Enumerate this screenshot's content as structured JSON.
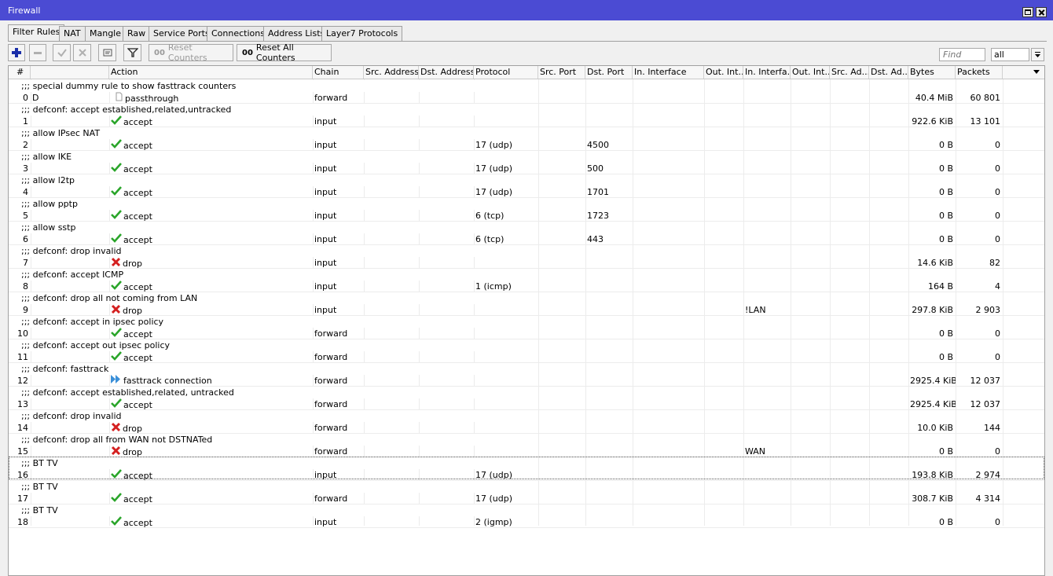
{
  "window": {
    "title": "Firewall"
  },
  "tabs": [
    {
      "label": "Filter Rules",
      "active": true
    },
    {
      "label": "NAT"
    },
    {
      "label": "Mangle"
    },
    {
      "label": "Raw"
    },
    {
      "label": "Service Ports"
    },
    {
      "label": "Connections"
    },
    {
      "label": "Address Lists"
    },
    {
      "label": "Layer7 Protocols"
    }
  ],
  "toolbar": {
    "add_icon": "plus-icon",
    "remove_icon": "minus-icon",
    "enable_icon": "check-icon",
    "disable_icon": "x-icon",
    "comment_icon": "comment-icon",
    "filter_icon": "filter-icon",
    "reset_counters_label": "Reset Counters",
    "reset_all_counters_label": "Reset All Counters",
    "counter_prefix": "00",
    "find_placeholder": "Find",
    "filter_select_value": "all"
  },
  "columns": [
    "#",
    "Action",
    "Chain",
    "Src. Address",
    "Dst. Address",
    "Protocol",
    "Src. Port",
    "Dst. Port",
    "In. Interface",
    "Out. Int...",
    "In. Interfa...",
    "Out. Int...",
    "Src. Ad...",
    "Dst. Ad...",
    "Bytes",
    "Packets"
  ],
  "rules": [
    {
      "comment": ";;; special dummy rule to show fasttrack counters",
      "num": "0",
      "flag": "D",
      "action": "passthrough",
      "action_icon": "document-icon",
      "chain": "forward",
      "protocol": "",
      "dst_port": "",
      "in_iface_list": "",
      "bytes": "40.4 MiB",
      "packets": "60 801"
    },
    {
      "comment": ";;; defconf: accept established,related,untracked",
      "num": "1",
      "flag": "",
      "action": "accept",
      "action_icon": "check-icon",
      "chain": "input",
      "protocol": "",
      "dst_port": "",
      "in_iface_list": "",
      "bytes": "922.6 KiB",
      "packets": "13 101"
    },
    {
      "comment": ";;; allow IPsec NAT",
      "num": "2",
      "flag": "",
      "action": "accept",
      "action_icon": "check-icon",
      "chain": "input",
      "protocol": "17 (udp)",
      "dst_port": "4500",
      "in_iface_list": "",
      "bytes": "0 B",
      "packets": "0"
    },
    {
      "comment": ";;; allow IKE",
      "num": "3",
      "flag": "",
      "action": "accept",
      "action_icon": "check-icon",
      "chain": "input",
      "protocol": "17 (udp)",
      "dst_port": "500",
      "in_iface_list": "",
      "bytes": "0 B",
      "packets": "0"
    },
    {
      "comment": ";;; allow l2tp",
      "num": "4",
      "flag": "",
      "action": "accept",
      "action_icon": "check-icon",
      "chain": "input",
      "protocol": "17 (udp)",
      "dst_port": "1701",
      "in_iface_list": "",
      "bytes": "0 B",
      "packets": "0"
    },
    {
      "comment": ";;; allow pptp",
      "num": "5",
      "flag": "",
      "action": "accept",
      "action_icon": "check-icon",
      "chain": "input",
      "protocol": "6 (tcp)",
      "dst_port": "1723",
      "in_iface_list": "",
      "bytes": "0 B",
      "packets": "0"
    },
    {
      "comment": ";;; allow sstp",
      "num": "6",
      "flag": "",
      "action": "accept",
      "action_icon": "check-icon",
      "chain": "input",
      "protocol": "6 (tcp)",
      "dst_port": "443",
      "in_iface_list": "",
      "bytes": "0 B",
      "packets": "0"
    },
    {
      "comment": ";;; defconf: drop invalid",
      "num": "7",
      "flag": "",
      "action": "drop",
      "action_icon": "x-icon",
      "chain": "input",
      "protocol": "",
      "dst_port": "",
      "in_iface_list": "",
      "bytes": "14.6 KiB",
      "packets": "82"
    },
    {
      "comment": ";;; defconf: accept ICMP",
      "num": "8",
      "flag": "",
      "action": "accept",
      "action_icon": "check-icon",
      "chain": "input",
      "protocol": "1 (icmp)",
      "dst_port": "",
      "in_iface_list": "",
      "bytes": "164 B",
      "packets": "4"
    },
    {
      "comment": ";;; defconf: drop all not coming from LAN",
      "num": "9",
      "flag": "",
      "action": "drop",
      "action_icon": "x-icon",
      "chain": "input",
      "protocol": "",
      "dst_port": "",
      "in_iface_list": "!LAN",
      "bytes": "297.8 KiB",
      "packets": "2 903"
    },
    {
      "comment": ";;; defconf: accept in ipsec policy",
      "num": "10",
      "flag": "",
      "action": "accept",
      "action_icon": "check-icon",
      "chain": "forward",
      "protocol": "",
      "dst_port": "",
      "in_iface_list": "",
      "bytes": "0 B",
      "packets": "0"
    },
    {
      "comment": ";;; defconf: accept out ipsec policy",
      "num": "11",
      "flag": "",
      "action": "accept",
      "action_icon": "check-icon",
      "chain": "forward",
      "protocol": "",
      "dst_port": "",
      "in_iface_list": "",
      "bytes": "0 B",
      "packets": "0"
    },
    {
      "comment": ";;; defconf: fasttrack",
      "num": "12",
      "flag": "",
      "action": "fasttrack connection",
      "action_icon": "fast-forward-icon",
      "chain": "forward",
      "protocol": "",
      "dst_port": "",
      "in_iface_list": "",
      "bytes": "2925.4 KiB",
      "packets": "12 037"
    },
    {
      "comment": ";;; defconf: accept established,related, untracked",
      "num": "13",
      "flag": "",
      "action": "accept",
      "action_icon": "check-icon",
      "chain": "forward",
      "protocol": "",
      "dst_port": "",
      "in_iface_list": "",
      "bytes": "2925.4 KiB",
      "packets": "12 037"
    },
    {
      "comment": ";;; defconf: drop invalid",
      "num": "14",
      "flag": "",
      "action": "drop",
      "action_icon": "x-icon",
      "chain": "forward",
      "protocol": "",
      "dst_port": "",
      "in_iface_list": "",
      "bytes": "10.0 KiB",
      "packets": "144"
    },
    {
      "comment": ";;; defconf:  drop all from WAN not DSTNATed",
      "num": "15",
      "flag": "",
      "action": "drop",
      "action_icon": "x-icon",
      "chain": "forward",
      "protocol": "",
      "dst_port": "",
      "in_iface_list": "WAN",
      "bytes": "0 B",
      "packets": "0"
    },
    {
      "comment": ";;; BT TV",
      "num": "16",
      "flag": "",
      "action": "accept",
      "action_icon": "check-icon",
      "chain": "input",
      "protocol": "17 (udp)",
      "dst_port": "",
      "in_iface_list": "",
      "bytes": "193.8 KiB",
      "packets": "2 974"
    },
    {
      "comment": ";;; BT TV",
      "num": "17",
      "flag": "",
      "action": "accept",
      "action_icon": "check-icon",
      "chain": "forward",
      "protocol": "17 (udp)",
      "dst_port": "",
      "in_iface_list": "",
      "bytes": "308.7 KiB",
      "packets": "4 314"
    },
    {
      "comment": ";;; BT TV",
      "num": "18",
      "flag": "",
      "action": "accept",
      "action_icon": "check-icon",
      "chain": "input",
      "protocol": "2 (igmp)",
      "dst_port": "",
      "in_iface_list": "",
      "bytes": "0 B",
      "packets": "0"
    }
  ],
  "colors": {
    "titlebar": "#4b4bd3",
    "accept": "#2aa52a",
    "drop": "#d42020",
    "fasttrack": "#3a8fd8",
    "add": "#1a2ea8"
  }
}
